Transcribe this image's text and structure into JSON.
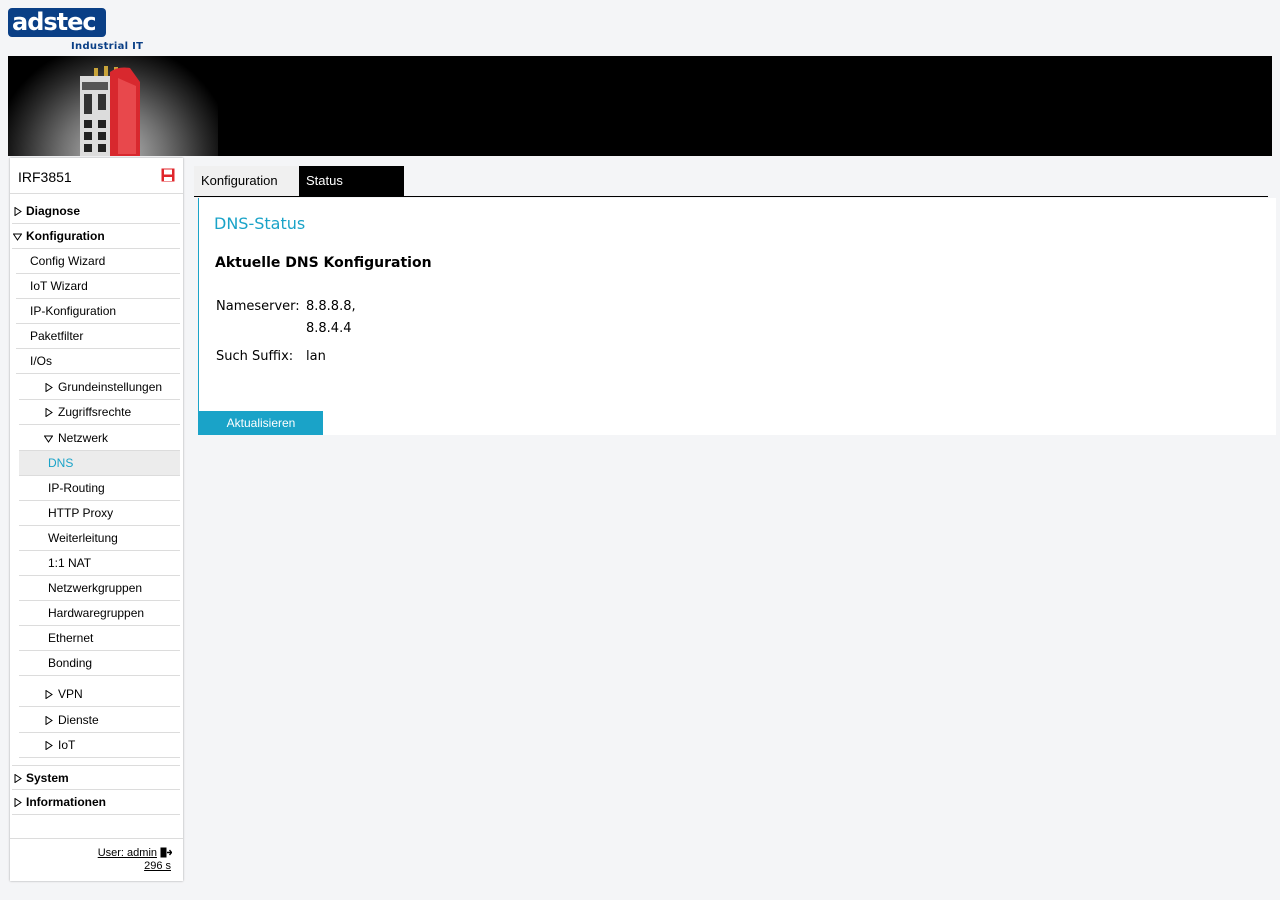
{
  "logo": {
    "brand": "adstec",
    "tagline": "Industrial IT"
  },
  "colors": {
    "accent": "#1aa3c8",
    "brand": "#0a3f86",
    "save_icon": "#e0262b"
  },
  "sidebar": {
    "device_name": "IRF3851",
    "save_icon": "save-icon",
    "nav": {
      "diagnose": "Diagnose",
      "konfiguration": "Konfiguration",
      "config_wizard": "Config Wizard",
      "iot_wizard": "IoT Wizard",
      "ip_konfiguration": "IP-Konfiguration",
      "paketfilter": "Paketfilter",
      "ios": "I/Os",
      "grundeinstellungen": "Grundeinstellungen",
      "zugriffsrechte": "Zugriffsrechte",
      "netzwerk": "Netzwerk",
      "dns": "DNS",
      "ip_routing": "IP-Routing",
      "http_proxy": "HTTP Proxy",
      "weiterleitung": "Weiterleitung",
      "nat": "1:1 NAT",
      "netzwerkgruppen": "Netzwerkgruppen",
      "hardwaregruppen": "Hardwaregruppen",
      "ethernet": "Ethernet",
      "bonding": "Bonding",
      "vpn": "VPN",
      "dienste": "Dienste",
      "iot": "IoT",
      "system": "System",
      "informationen": "Informationen"
    },
    "footer": {
      "user": "User: admin",
      "timer": "296 s"
    }
  },
  "tabs": {
    "konfiguration": "Konfiguration",
    "status": "Status"
  },
  "content": {
    "title": "DNS-Status",
    "section": "Aktuelle DNS Konfiguration",
    "nameserver_label": "Nameserver:",
    "nameserver_1": "8.8.8.8,",
    "nameserver_2": "8.8.4.4",
    "suffix_label": "Such Suffix:",
    "suffix_value": "lan",
    "refresh_button": "Aktualisieren"
  }
}
